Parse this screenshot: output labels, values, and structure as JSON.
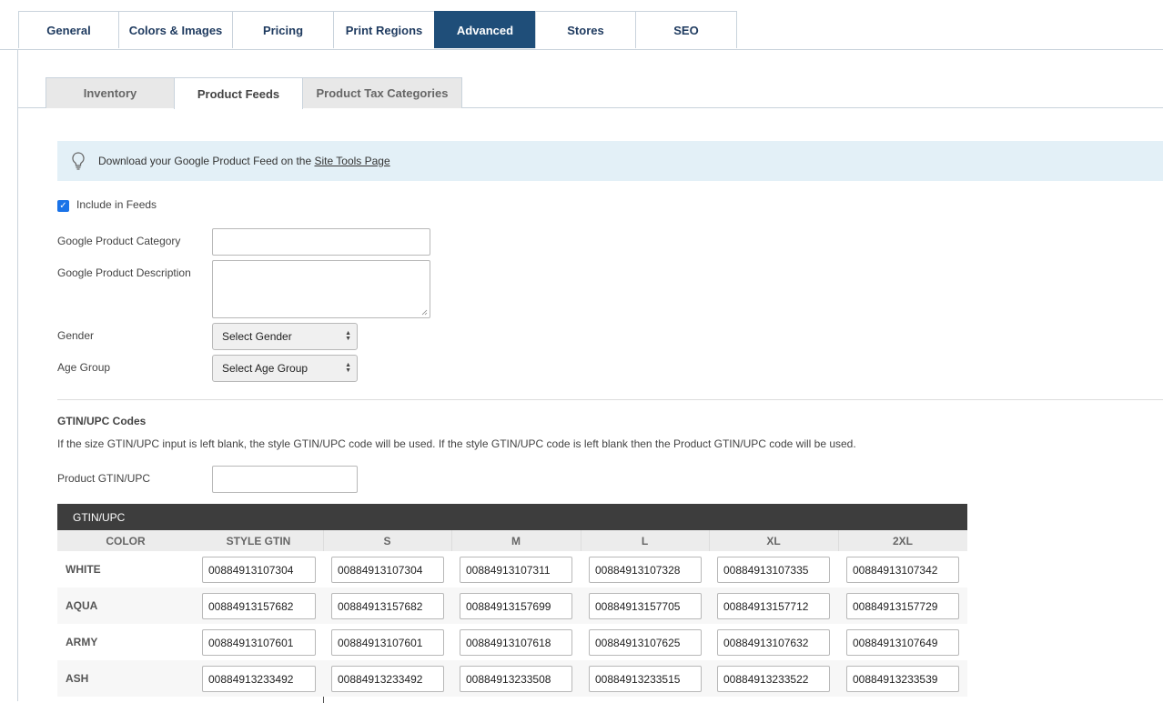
{
  "tabs": [
    {
      "label": "General",
      "active": false
    },
    {
      "label": "Colors & Images",
      "active": false
    },
    {
      "label": "Pricing",
      "active": false
    },
    {
      "label": "Print Regions",
      "active": false
    },
    {
      "label": "Advanced",
      "active": true
    },
    {
      "label": "Stores",
      "active": false
    },
    {
      "label": "SEO",
      "active": false
    }
  ],
  "subtabs": [
    {
      "label": "Inventory",
      "active": false
    },
    {
      "label": "Product Feeds",
      "active": true
    },
    {
      "label": "Product Tax Categories",
      "active": false
    }
  ],
  "info": {
    "icon": "lightbulb-icon",
    "text": "Download your Google Product Feed on the ",
    "link": "Site Tools Page"
  },
  "form": {
    "include_label": "Include in Feeds",
    "include_checked": true,
    "category_label": "Google Product Category",
    "category_value": "",
    "description_label": "Google Product Description",
    "description_value": "",
    "gender_label": "Gender",
    "gender_value": "Select Gender",
    "age_label": "Age Group",
    "age_value": "Select Age Group"
  },
  "gtin": {
    "heading": "GTIN/UPC Codes",
    "description": "If the size GTIN/UPC input is left blank, the style GTIN/UPC code will be used. If the style GTIN/UPC code is left blank then the Product GTIN/UPC code will be used.",
    "product_label": "Product GTIN/UPC",
    "product_value": ""
  },
  "grid": {
    "title": "GTIN/UPC",
    "columns": [
      "COLOR",
      "STYLE GTIN",
      "S",
      "M",
      "L",
      "XL",
      "2XL"
    ],
    "rows": [
      {
        "color": "WHITE",
        "values": [
          "00884913107304",
          "00884913107304",
          "00884913107311",
          "00884913107328",
          "00884913107335",
          "00884913107342"
        ]
      },
      {
        "color": "AQUA",
        "values": [
          "00884913157682",
          "00884913157682",
          "00884913157699",
          "00884913157705",
          "00884913157712",
          "00884913157729"
        ]
      },
      {
        "color": "ARMY",
        "values": [
          "00884913107601",
          "00884913107601",
          "00884913107618",
          "00884913107625",
          "00884913107632",
          "00884913107649"
        ]
      },
      {
        "color": "ASH",
        "values": [
          "00884913233492",
          "00884913233492",
          "00884913233508",
          "00884913233515",
          "00884913233522",
          "00884913233539"
        ]
      }
    ]
  }
}
